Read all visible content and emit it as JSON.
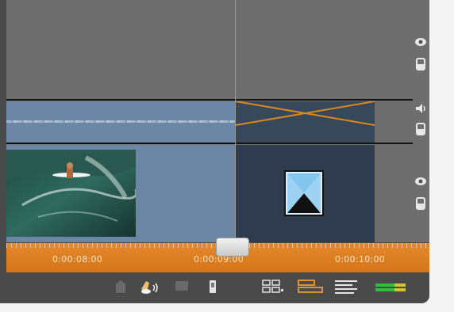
{
  "ruler": {
    "labels": [
      "0:00:08:00",
      "0:00:09:00",
      "0:00:10:00"
    ]
  },
  "icons": {
    "track_header": [
      "eye-icon",
      "lock-icon",
      "speaker-icon",
      "lock-icon",
      "eye-icon",
      "lock-icon"
    ],
    "toolbar": [
      "delete-icon",
      "audio-tool-icon",
      "screen-icon",
      "clip-icon",
      "storyboard-view-icon",
      "timeline-view-icon",
      "text-view-icon",
      "audio-level-meter-icon"
    ]
  },
  "colors": {
    "ruler": "#d97d20",
    "clip": "#6b87a5",
    "transition": "#2f3c4d",
    "transition_cross": "#d88a1e",
    "active_view": "#e0922b"
  }
}
